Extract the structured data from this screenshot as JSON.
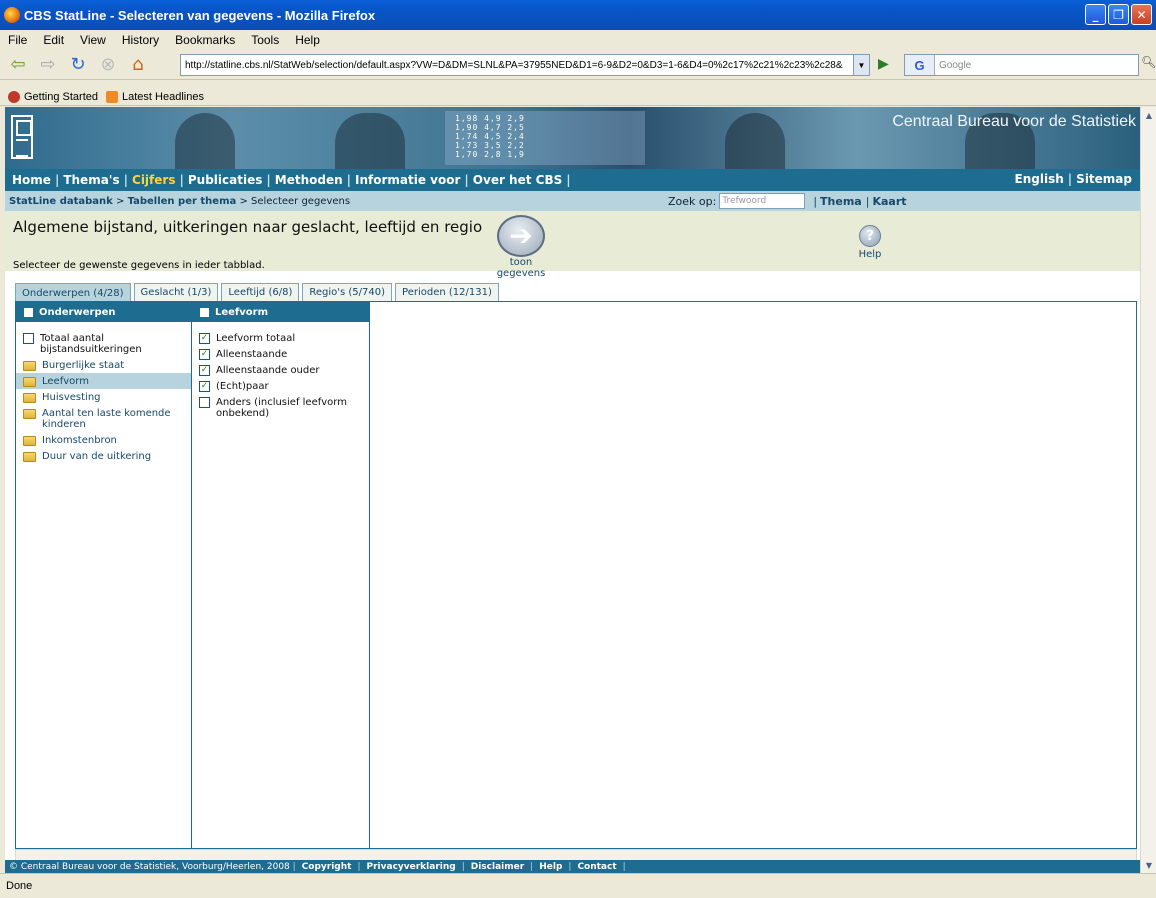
{
  "window": {
    "title": "CBS StatLine - Selecteren van gegevens - Mozilla Firefox"
  },
  "menu": [
    "File",
    "Edit",
    "View",
    "History",
    "Bookmarks",
    "Tools",
    "Help"
  ],
  "toolbar": {
    "url": "http://statline.cbs.nl/StatWeb/selection/default.aspx?VW=D&DM=SLNL&PA=37955NED&D1=6-9&D2=0&D3=1-6&D4=0%2c17%2c21%2c23%2c28&",
    "search_placeholder": "Google"
  },
  "bookmarks": [
    "Getting Started",
    "Latest Headlines"
  ],
  "banner": {
    "org_name": "Centraal Bureau voor de Statistiek",
    "numbers": [
      "1,98   4,9   2,9",
      "1,90   4,7   2,5",
      "1,74   4,5   2,4",
      "1,73   3,5   2,2",
      "1,70   2,8   1,9"
    ]
  },
  "nav": {
    "items": [
      "Home",
      "Thema's",
      "Cijfers",
      "Publicaties",
      "Methoden",
      "Informatie voor",
      "Over het CBS"
    ],
    "active": "Cijfers",
    "right": [
      "English",
      "Sitemap"
    ]
  },
  "breadcrumb": {
    "link1": "StatLine databank",
    "link2": "Tabellen per thema",
    "current": "Selecteer gegevens",
    "sep": ">"
  },
  "zoek": {
    "label": "Zoek op:",
    "placeholder": "Trefwoord",
    "thema": "Thema",
    "kaart": "Kaart"
  },
  "header": {
    "title": "Algemene bijstand, uitkeringen naar geslacht, leeftijd en regio",
    "subtitle": "Selecteer de gewenste gegevens in ieder tabblad.",
    "toon_label": "toon gegevens",
    "help_label": "Help"
  },
  "tabs": [
    "Onderwerpen (4/28)",
    "Geslacht (1/3)",
    "Leeftijd (6/8)",
    "Regio's (5/740)",
    "Perioden (12/131)"
  ],
  "col1": {
    "header": "Onderwerpen",
    "items": [
      {
        "label": "Totaal aantal bijstandsuitkeringen",
        "type": "checkbox",
        "checked": false
      },
      {
        "label": "Burgerlijke staat",
        "type": "folder"
      },
      {
        "label": "Leefvorm",
        "type": "folder",
        "selected": true
      },
      {
        "label": "Huisvesting",
        "type": "folder"
      },
      {
        "label": "Aantal ten laste komende kinderen",
        "type": "folder"
      },
      {
        "label": "Inkomstenbron",
        "type": "folder"
      },
      {
        "label": "Duur van de uitkering",
        "type": "folder"
      }
    ]
  },
  "col2": {
    "header": "Leefvorm",
    "items": [
      {
        "label": "Leefvorm totaal",
        "checked": true
      },
      {
        "label": "Alleenstaande",
        "checked": true
      },
      {
        "label": "Alleenstaande ouder",
        "checked": true
      },
      {
        "label": "(Echt)paar",
        "checked": true
      },
      {
        "label": "Anders (inclusief leefvorm onbekend)",
        "checked": false
      }
    ]
  },
  "footer": {
    "copyright": "© Centraal Bureau voor de Statistiek, Voorburg/Heerlen, 2008",
    "links": [
      "Copyright",
      "Privacyverklaring",
      "Disclaimer",
      "Help",
      "Contact"
    ]
  },
  "status": "Done",
  "colors": {
    "accent": "#1e6c8f",
    "crumb": "#b7d3dd",
    "header_bg": "#e8ebd6",
    "active_nav": "#ffd23a"
  }
}
